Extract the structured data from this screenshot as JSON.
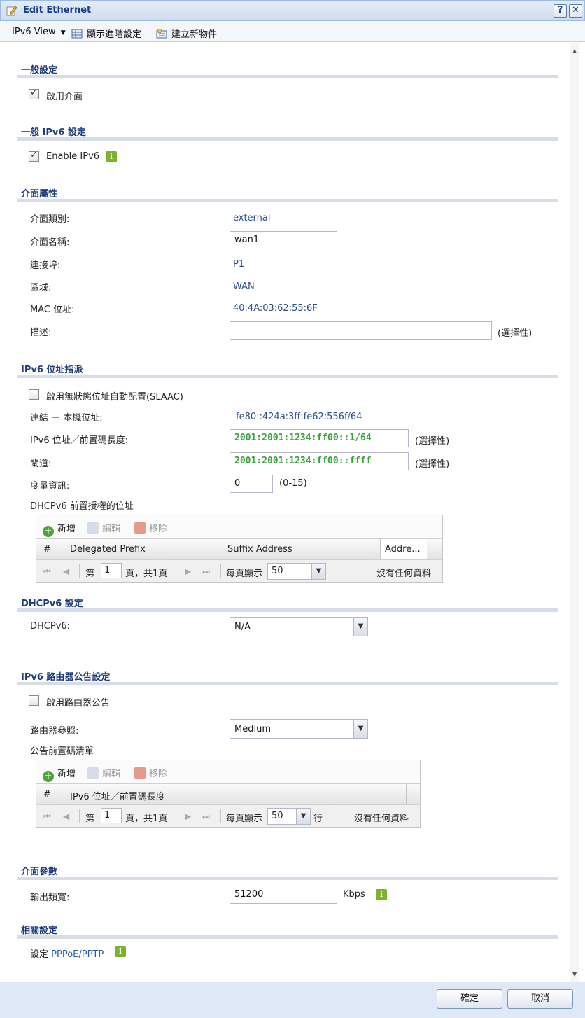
{
  "window": {
    "title": "Edit Ethernet",
    "help_label": "?",
    "close_label": "✕"
  },
  "toolbar": {
    "view_label": "IPv6 View",
    "advanced_label": "顯示進階設定",
    "create_label": "建立新物件"
  },
  "general": {
    "title": "一般設定",
    "enable_interface": "啟用介面",
    "enable_checked": true
  },
  "general_ipv6": {
    "title": "一般 IPv6 設定",
    "enable_ipv6": "Enable IPv6",
    "enable_checked": true
  },
  "interface": {
    "title": "介面屬性",
    "type_label": "介面類別:",
    "type_value": "external",
    "name_label": "介面名稱:",
    "name_value": "wan1",
    "port_label": "連接埠:",
    "port_value": "P1",
    "zone_label": "區域:",
    "zone_value": "WAN",
    "mac_label": "MAC 位址:",
    "mac_value": "40:4A:03:62:55:6F",
    "desc_label": "描述:",
    "desc_value": "",
    "desc_hint": "(選擇性)"
  },
  "ipv6_assign": {
    "title": "IPv6 位址指派",
    "slaac_label": "啟用無狀態位址自動配置(SLAAC)",
    "slaac_checked": false,
    "linklocal_label": "連結 － 本機位址:",
    "linklocal_value": "fe80::424a:3ff:fe62:556f/64",
    "addr_label": "IPv6 位址／前置碼長度:",
    "addr_value": "2001:2001:1234:ff00::1/64",
    "addr_hint": "(選擇性)",
    "gw_label": "閘道:",
    "gw_value": "2001:2001:1234:ff00::ffff",
    "gw_hint": "(選擇性)",
    "metric_label": "度量資訊:",
    "metric_value": "0",
    "metric_hint": "(0-15)",
    "dhcp_pd_label": "DHCPv6 前置授權的位址"
  },
  "grid1": {
    "add": "新增",
    "edit": "編輯",
    "remove": "移除",
    "columns": [
      "#",
      "Delegated Prefix",
      "Suffix Address",
      "Addre..."
    ],
    "page_prefix": "第",
    "page_num": "1",
    "page_suffix": "頁，共1頁",
    "per_page_label": "每頁顯示",
    "per_page_value": "50",
    "empty_text": "沒有任何資料"
  },
  "dhcpv6": {
    "title": "DHCPv6 設定",
    "label": "DHCPv6:",
    "value": "N/A"
  },
  "ra": {
    "title": "IPv6 路由器公告設定",
    "enable_label": "啟用路由器公告",
    "enable_checked": false,
    "pref_label": "路由器參照:",
    "pref_value": "Medium",
    "prefix_list_label": "公告前置碼清單"
  },
  "grid2": {
    "add": "新增",
    "edit": "編輯",
    "remove": "移除",
    "columns": [
      "#",
      "IPv6 位址／前置碼長度"
    ],
    "page_prefix": "第",
    "page_num": "1",
    "page_suffix": "頁，共1頁",
    "per_page_label": "每頁顯示",
    "per_page_value": "50",
    "per_page_unit": "行",
    "empty_text": "沒有任何資料"
  },
  "params": {
    "title": "介面參數",
    "bw_label": "輸出頻寬:",
    "bw_value": "51200",
    "bw_unit": "Kbps"
  },
  "related": {
    "title": "相關設定",
    "prefix": "設定",
    "link": "PPPoE/PPTP"
  },
  "footer": {
    "ok": "確定",
    "cancel": "取消"
  },
  "colors": {
    "title_blue": "#15428b",
    "section_blue": "#1e3c7a",
    "info_green": "#7bb32e",
    "ipv6_green": "#3aa23a"
  }
}
